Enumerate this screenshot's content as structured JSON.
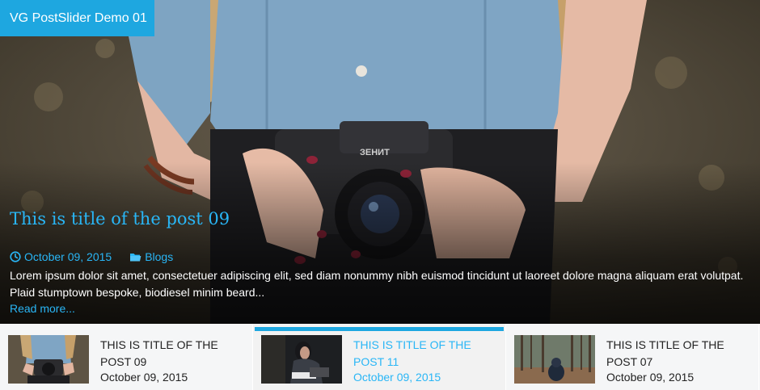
{
  "slider": {
    "badge": "VG PostSlider Demo 01",
    "post": {
      "title": "This is title of the post 09",
      "date": "October 09, 2015",
      "category": "Blogs",
      "excerpt": "Lorem ipsum dolor sit amet, consectetuer adipiscing elit, sed diam nonummy nibh euismod tincidunt ut laoreet dolore magna aliquam erat volutpat. Plaid stumptown bespoke, biodiesel minim beard...",
      "read_more": "Read more..."
    }
  },
  "thumbs": [
    {
      "title": "This is title of the post 09",
      "date": "October 09, 2015",
      "active": false
    },
    {
      "title": "This is title of the post 11",
      "date": "October 09, 2015",
      "active": true
    },
    {
      "title": "This is title of the post 07",
      "date": "October 09, 2015",
      "active": false
    }
  ],
  "colors": {
    "accent": "#1ea7e0",
    "link": "#29b6f6"
  },
  "icons": {
    "date": "clock-icon",
    "category": "folder-icon"
  }
}
